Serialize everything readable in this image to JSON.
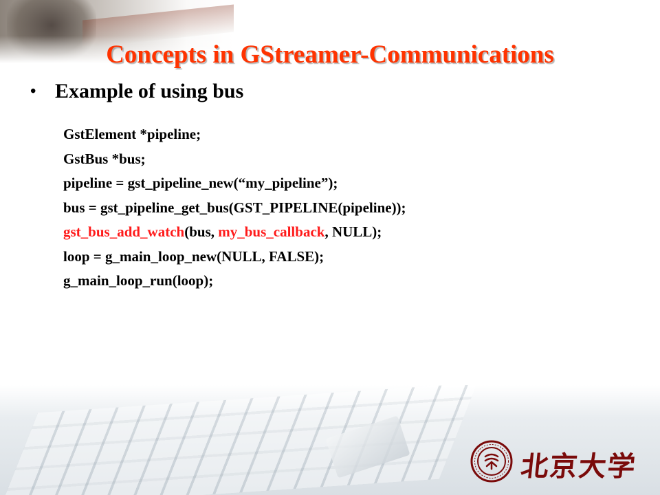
{
  "slide": {
    "title": "Concepts in GStreamer-Communications",
    "bullet": "Example of using bus",
    "code_lines": [
      {
        "parts": [
          {
            "text": "GstElement *pipeline;",
            "red": false
          }
        ]
      },
      {
        "parts": [
          {
            "text": "GstBus *bus;",
            "red": false
          }
        ]
      },
      {
        "parts": [
          {
            "text": "pipeline = gst_pipeline_new(“my_pipeline”);",
            "red": false
          }
        ]
      },
      {
        "parts": [
          {
            "text": "bus = gst_pipeline_get_bus(GST_PIPELINE(pipeline));",
            "red": false
          }
        ]
      },
      {
        "parts": [
          {
            "text": "gst_bus_add_watch",
            "red": true
          },
          {
            "text": "(bus, ",
            "red": false
          },
          {
            "text": "my_bus_callback",
            "red": true
          },
          {
            "text": ", NULL);",
            "red": false
          }
        ]
      },
      {
        "parts": [
          {
            "text": "loop = g_main_loop_new(NULL, FALSE);",
            "red": false
          }
        ]
      },
      {
        "parts": [
          {
            "text": "g_main_loop_run(loop);",
            "red": false
          }
        ]
      }
    ]
  },
  "branding": {
    "logo_icon": "university-seal-icon",
    "calligraphy": "北京大学"
  },
  "colors": {
    "title": "#ff3300",
    "code_highlight": "#ff1a1a",
    "seal": "#7a0a0a"
  }
}
